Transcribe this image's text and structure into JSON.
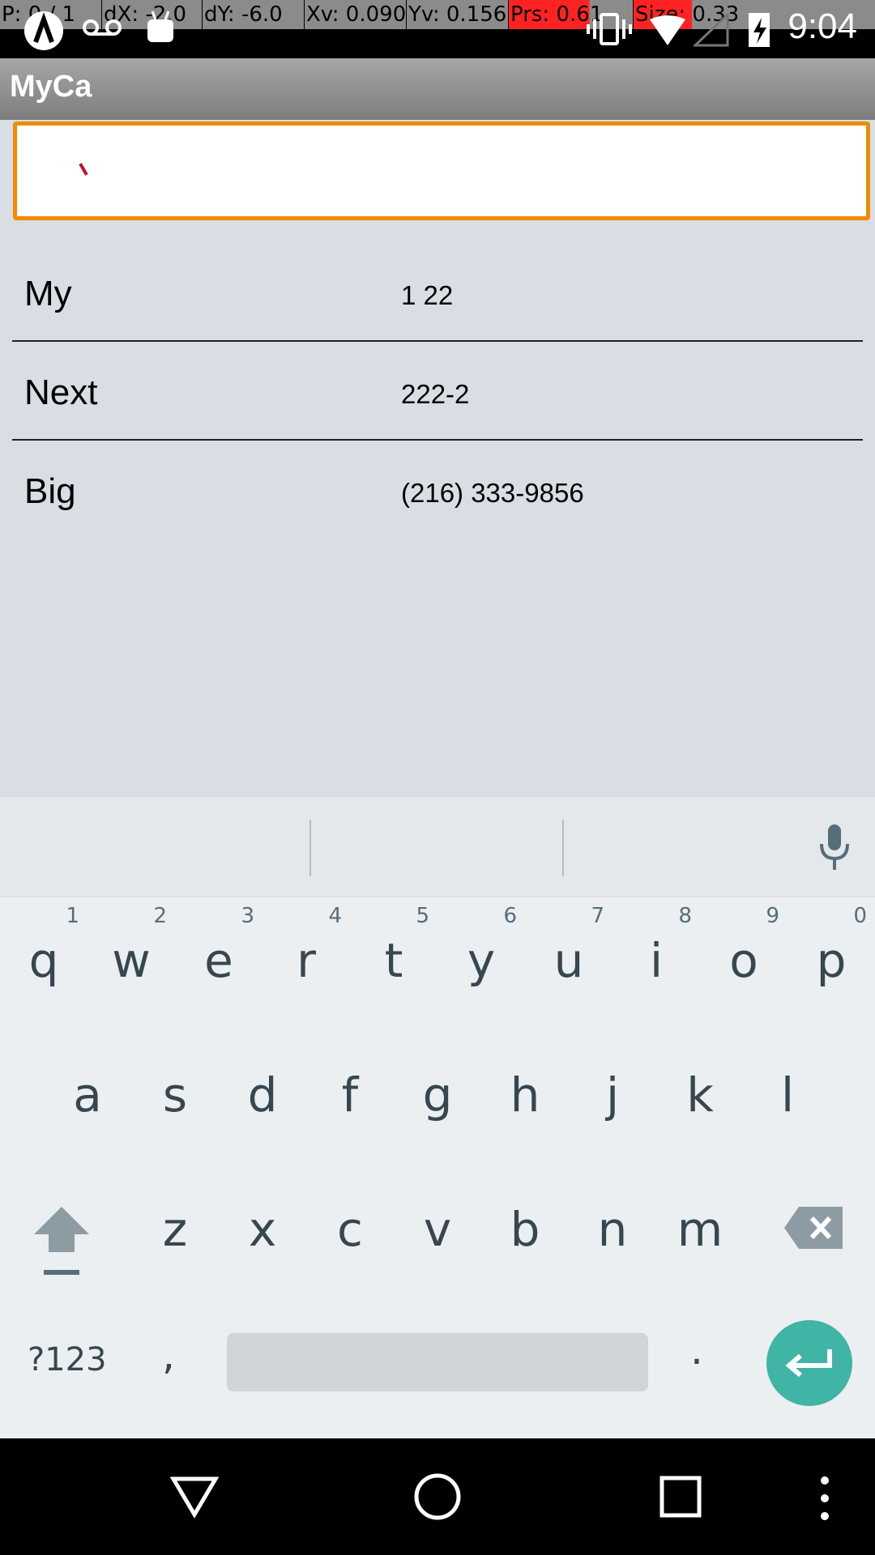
{
  "status_bar": {
    "debug": {
      "p": "P: 0 / 1",
      "dx": "dX: -2.0",
      "dy": "dY: -6.0",
      "xv": "Xv: 0.090",
      "yv": "Yv: 0.156",
      "prs": "Prs: 0.61",
      "size": "Size: 0.33"
    },
    "time": "9:04",
    "icons": [
      "app-notification-icon",
      "voicemail-icon",
      "android-icon",
      "vibrate-icon",
      "wifi-icon",
      "signal-icon",
      "battery-charging-icon"
    ]
  },
  "app_bar": {
    "title": "MyCa"
  },
  "search": {
    "value": "",
    "placeholder": ""
  },
  "contacts": [
    {
      "name": "My",
      "number": "1 22"
    },
    {
      "name": "Next",
      "number": "222-2"
    },
    {
      "name": "Big",
      "number": "(216) 333-9856"
    }
  ],
  "keyboard": {
    "row1": [
      {
        "letter": "q",
        "hint": "1"
      },
      {
        "letter": "w",
        "hint": "2"
      },
      {
        "letter": "e",
        "hint": "3"
      },
      {
        "letter": "r",
        "hint": "4"
      },
      {
        "letter": "t",
        "hint": "5"
      },
      {
        "letter": "y",
        "hint": "6"
      },
      {
        "letter": "u",
        "hint": "7"
      },
      {
        "letter": "i",
        "hint": "8"
      },
      {
        "letter": "o",
        "hint": "9"
      },
      {
        "letter": "p",
        "hint": "0"
      }
    ],
    "row2": [
      "a",
      "s",
      "d",
      "f",
      "g",
      "h",
      "j",
      "k",
      "l"
    ],
    "row3": [
      "z",
      "x",
      "c",
      "v",
      "b",
      "n",
      "m"
    ],
    "symbols_label": "?123",
    "comma": ",",
    "period": "."
  },
  "colors": {
    "accent": "#f08a00",
    "enter": "#40b5a6",
    "keyboard_bg": "#eceff1",
    "list_bg": "#d8dee4"
  }
}
